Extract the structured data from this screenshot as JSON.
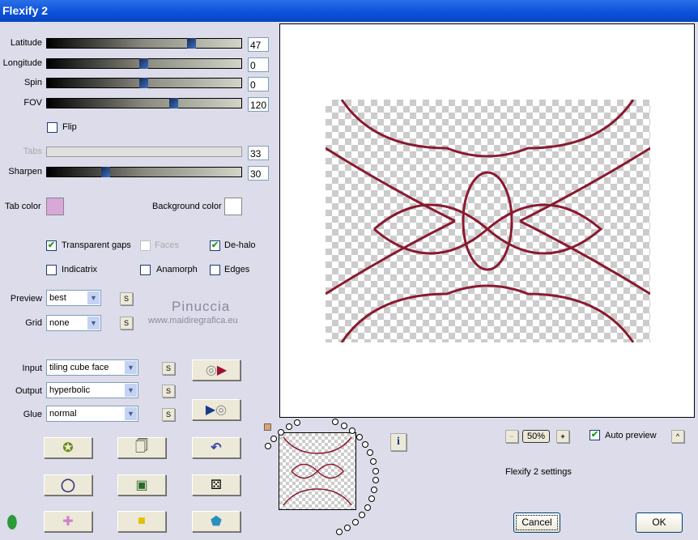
{
  "window": {
    "title": "Flexify 2"
  },
  "sliders": [
    {
      "label": "Latitude",
      "value": "47",
      "fraction": 0.74
    },
    {
      "label": "Longitude",
      "value": "0",
      "fraction": 0.5
    },
    {
      "label": "Spin",
      "value": "0",
      "fraction": 0.5
    },
    {
      "label": "FOV",
      "value": "120",
      "fraction": 0.66
    },
    {
      "label": "Tabs",
      "value": "33",
      "fraction": null
    },
    {
      "label": "Sharpen",
      "value": "30",
      "fraction": 0.3
    }
  ],
  "flip": {
    "label": "Flip",
    "checked": false
  },
  "colors": {
    "tab_label": "Tab color",
    "tab_color": "#d8a8d8",
    "bg_label": "Background color",
    "bg_color": "#ffffff"
  },
  "options": [
    {
      "label": "Transparent gaps",
      "checked": true
    },
    {
      "label": "Faces",
      "checked": false,
      "disabled": true
    },
    {
      "label": "De-halo",
      "checked": true
    },
    {
      "label": "Indicatrix",
      "checked": false
    },
    {
      "label": "Anamorph",
      "checked": false
    },
    {
      "label": "Edges",
      "checked": false
    }
  ],
  "preview_select": {
    "label": "Preview",
    "value": "best"
  },
  "grid_select": {
    "label": "Grid",
    "value": "none"
  },
  "watermark": {
    "name": "Pinuccia",
    "url": "www.maidiregrafica.eu"
  },
  "input": {
    "label": "Input",
    "value": "tiling cube face"
  },
  "output": {
    "label": "Output",
    "value": "hyperbolic"
  },
  "glue": {
    "label": "Glue",
    "value": "normal"
  },
  "s_label": "S",
  "zoom": {
    "minus": "−",
    "value": "50%",
    "plus": "+"
  },
  "auto_preview": {
    "label": "Auto preview",
    "checked": true
  },
  "collapse": "^",
  "info": "i",
  "settings_label": "Flexify 2 settings",
  "cancel": "Cancel",
  "ok": "OK",
  "check": "✔"
}
